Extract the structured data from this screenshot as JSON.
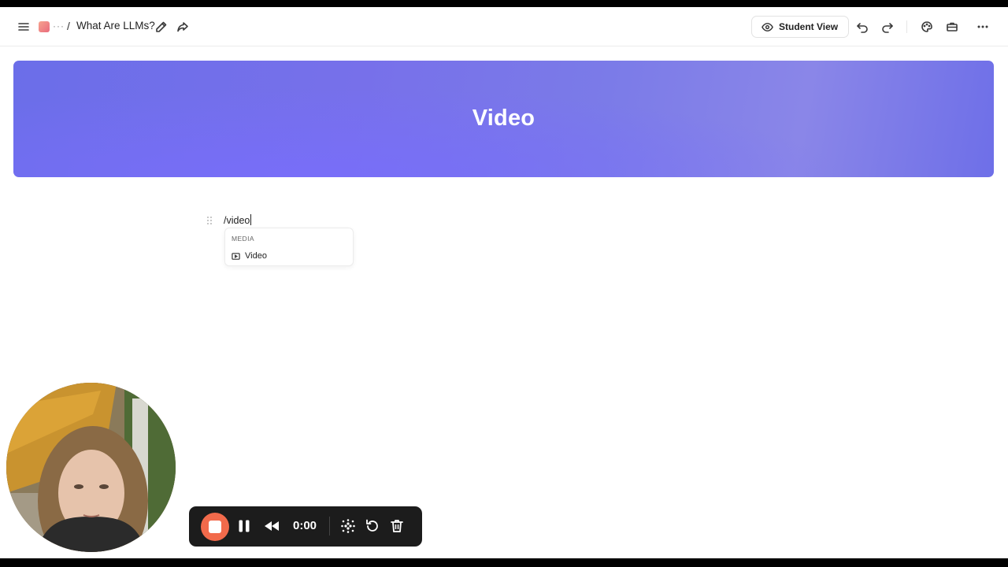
{
  "topbar": {
    "title": "What Are LLMs?",
    "crumb_more": "···",
    "crumb_separator": "/",
    "student_view_label": "Student View",
    "icons": [
      "menu-icon",
      "page-icon",
      "pencil-icon",
      "share-icon",
      "eye-icon",
      "undo-icon",
      "redo-icon",
      "palette-icon",
      "briefcase-icon",
      "more-icon"
    ]
  },
  "banner": {
    "title": "Video",
    "colors": [
      "#6b6ee9",
      "#8a86e8"
    ]
  },
  "editor": {
    "input_text": "/video"
  },
  "slash_menu": {
    "section_header": "MEDIA",
    "items": [
      {
        "label": "Video",
        "icon": "video-icon"
      }
    ]
  },
  "recorder": {
    "time": "0:00",
    "accent_color": "#f26a4b",
    "controls": [
      "stop-icon",
      "pause-icon",
      "rewind-icon",
      "grid-icon",
      "restart-icon",
      "trash-icon"
    ]
  }
}
